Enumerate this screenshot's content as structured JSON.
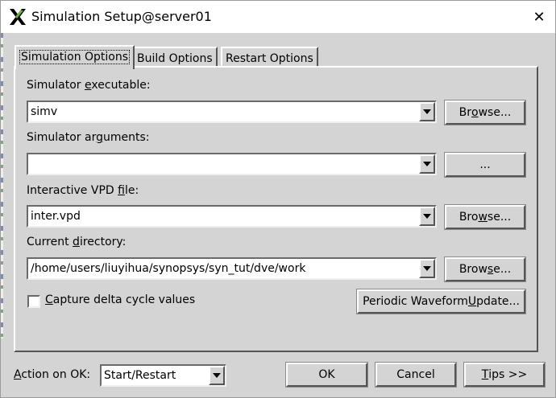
{
  "window": {
    "title": "Simulation Setup@server01",
    "close_glyph": "✕",
    "icon": "x-logo-icon"
  },
  "tabs": [
    {
      "label": "Simulation Options",
      "active": true
    },
    {
      "label": "Build Options",
      "active": false
    },
    {
      "label": "Restart Options",
      "active": false
    }
  ],
  "simulator_executable": {
    "label_pre": "Simulator ",
    "label_u": "e",
    "label_post": "xecutable:",
    "value": "simv",
    "button_pre": "Br",
    "button_u": "o",
    "button_post": "wse..."
  },
  "simulator_arguments": {
    "label_pre": "Simulator ar",
    "label_u": "g",
    "label_post": "uments:",
    "value": "",
    "button": "..."
  },
  "vpd_file": {
    "label_pre": "Interactive VPD ",
    "label_u": "f",
    "label_post": "ile:",
    "value": "inter.vpd",
    "button_pre": "Bro",
    "button_u": "w",
    "button_post": "se..."
  },
  "current_directory": {
    "label_pre": "Current ",
    "label_u": "d",
    "label_post": "irectory:",
    "value": "/home/users/liuyihua/synopsys/syn_tut/dve/work",
    "button_pre": "Brow",
    "button_u": "s",
    "button_post": "e..."
  },
  "capture_delta": {
    "label_u": "C",
    "label_post": "apture delta cycle values",
    "checked": false
  },
  "periodic_update": {
    "pre": "Periodic Waveform ",
    "u": "U",
    "post": "pdate..."
  },
  "footer": {
    "action_label_u": "A",
    "action_label_post": "ction on OK:",
    "action_value": "Start/Restart",
    "ok": "OK",
    "cancel": "Cancel",
    "tips_u": "T",
    "tips_post": "ips >>"
  },
  "colors": {
    "dialog_bg": "#d4d4d4",
    "title_bg": "#ffffff",
    "logo_black": "#000000",
    "logo_green": "#6bb43c"
  }
}
